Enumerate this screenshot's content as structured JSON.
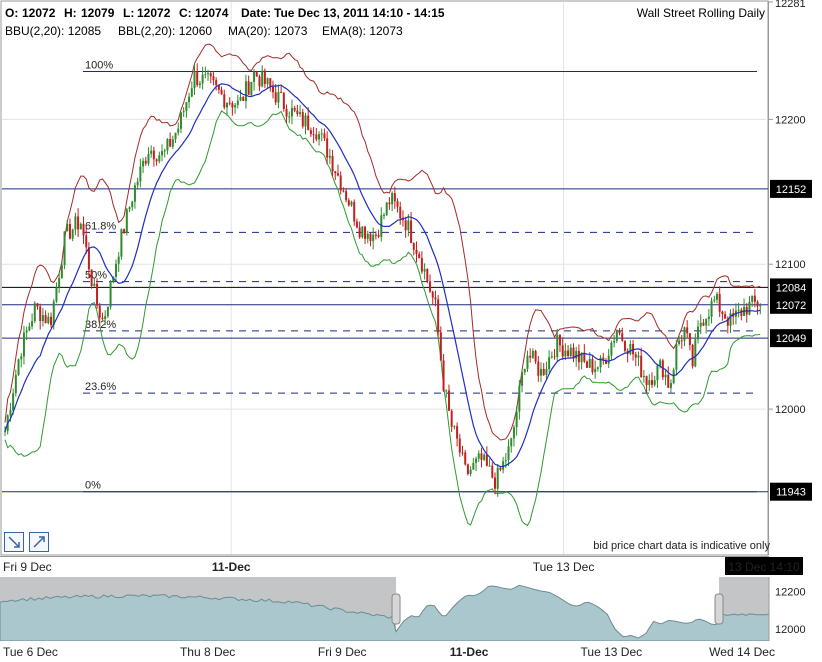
{
  "header": {
    "ohlc": [
      {
        "label": "O:",
        "value": "12072"
      },
      {
        "label": "H:",
        "value": "12079"
      },
      {
        "label": "L:",
        "value": "12072"
      },
      {
        "label": "C:",
        "value": "12074"
      }
    ],
    "date_label": "Date:",
    "date_value": "Tue Dec 13, 2011 14:10 - 14:15",
    "instrument": "Wall Street Rolling Daily",
    "indicators": [
      {
        "label": "BBU(2,20): 12085",
        "color": "#b22222"
      },
      {
        "label": "BBL(2,20): 12060",
        "color": "#2e8b2e"
      },
      {
        "label": "MA(20): 12073",
        "color": "#2233bb"
      },
      {
        "label": "EMA(8): 12073",
        "color": "#b22222"
      }
    ]
  },
  "note": "bid price chart data is indicative only",
  "tools": [
    {
      "name": "trend-down-tool-button",
      "icon": "arrow-down-right-icon"
    },
    {
      "name": "trend-up-tool-button",
      "icon": "arrow-up-right-icon"
    }
  ],
  "colors": {
    "candle_up": "#2e8b2e",
    "candle_down": "#c41e1e",
    "bb_upper": "#a52a2a",
    "bb_lower": "#2e9a2e",
    "ma": "#1f2fbf",
    "level_line": "#1a2a80",
    "price_tag_bg": "#000000",
    "navigator_fill": "#a9c7cc",
    "navigator_bg": "#bfc1c3"
  },
  "chart_data": {
    "type": "candlestick",
    "title": "Wall Street Rolling Daily",
    "ylim": [
      11900,
      12281
    ],
    "y_ticks": [
      {
        "value": 12281,
        "label": "12281"
      },
      {
        "value": 12200,
        "label": "12200"
      },
      {
        "value": 12100,
        "label": "12100"
      },
      {
        "value": 12000,
        "label": "12000"
      }
    ],
    "x_ticks": [
      {
        "label": "Fri 9 Dec",
        "x": 0.0,
        "bold": false
      },
      {
        "label": "11-Dec",
        "x": 0.3,
        "bold": true
      },
      {
        "label": "Tue 13 Dec",
        "x": 0.735,
        "bold": false
      }
    ],
    "current_time_label": "13 Dec 14:10",
    "horizontal_levels": [
      {
        "value": 12152,
        "label": "12152",
        "style": "solid"
      },
      {
        "value": 12084,
        "label": "12084",
        "style": "solid-black"
      },
      {
        "value": 12072,
        "label": "12072",
        "style": "solid"
      },
      {
        "value": 12049,
        "label": "12049",
        "style": "solid"
      },
      {
        "value": 11943,
        "label": "11943",
        "style": "solid"
      }
    ],
    "fibonacci": {
      "high": 12233,
      "low": 11943,
      "levels": [
        {
          "label": "100%",
          "value": 12233
        },
        {
          "label": "61.8%",
          "value": 12122
        },
        {
          "label": "50%",
          "value": 12088
        },
        {
          "label": "38.2%",
          "value": 12054
        },
        {
          "label": "23.6%",
          "value": 12011
        },
        {
          "label": "0%",
          "value": 11943
        }
      ]
    },
    "price_path": [
      [
        0.0,
        11985
      ],
      [
        0.02,
        12040
      ],
      [
        0.04,
        12070
      ],
      [
        0.06,
        12060
      ],
      [
        0.08,
        12120
      ],
      [
        0.1,
        12130
      ],
      [
        0.12,
        12075
      ],
      [
        0.13,
        12060
      ],
      [
        0.15,
        12110
      ],
      [
        0.17,
        12150
      ],
      [
        0.19,
        12180
      ],
      [
        0.21,
        12175
      ],
      [
        0.23,
        12195
      ],
      [
        0.25,
        12230
      ],
      [
        0.27,
        12225
      ],
      [
        0.29,
        12215
      ],
      [
        0.31,
        12210
      ],
      [
        0.33,
        12232
      ],
      [
        0.35,
        12222
      ],
      [
        0.37,
        12210
      ],
      [
        0.39,
        12200
      ],
      [
        0.41,
        12195
      ],
      [
        0.43,
        12175
      ],
      [
        0.45,
        12150
      ],
      [
        0.47,
        12125
      ],
      [
        0.49,
        12120
      ],
      [
        0.51,
        12145
      ],
      [
        0.53,
        12130
      ],
      [
        0.55,
        12105
      ],
      [
        0.57,
        12070
      ],
      [
        0.58,
        12020
      ],
      [
        0.59,
        11990
      ],
      [
        0.6,
        11975
      ],
      [
        0.61,
        11955
      ],
      [
        0.63,
        11965
      ],
      [
        0.65,
        11950
      ],
      [
        0.67,
        11975
      ],
      [
        0.69,
        12040
      ],
      [
        0.71,
        12025
      ],
      [
        0.73,
        12045
      ],
      [
        0.75,
        12040
      ],
      [
        0.77,
        12030
      ],
      [
        0.79,
        12030
      ],
      [
        0.81,
        12055
      ],
      [
        0.83,
        12040
      ],
      [
        0.85,
        12020
      ],
      [
        0.87,
        12030
      ],
      [
        0.88,
        12015
      ],
      [
        0.89,
        12045
      ],
      [
        0.9,
        12055
      ],
      [
        0.91,
        12030
      ],
      [
        0.92,
        12060
      ],
      [
        0.94,
        12075
      ],
      [
        0.96,
        12060
      ],
      [
        0.98,
        12070
      ],
      [
        1.0,
        12074
      ]
    ]
  },
  "navigator": {
    "x_ticks": [
      {
        "label": "Tue 6 Dec",
        "x": 0.0,
        "bold": false
      },
      {
        "label": "Thu 8 Dec",
        "x": 0.27,
        "bold": false
      },
      {
        "label": "Fri 9 Dec",
        "x": 0.445,
        "bold": false
      },
      {
        "label": "11-Dec",
        "x": 0.61,
        "bold": true
      },
      {
        "label": "Tue 13 Dec",
        "x": 0.795,
        "bold": false
      },
      {
        "label": "Wed 14 Dec",
        "x": 0.965,
        "bold": false
      }
    ],
    "y_ticks": [
      {
        "value": 12200,
        "label": "12200"
      },
      {
        "value": 12000,
        "label": "12000"
      }
    ],
    "window": [
      0.515,
      0.935
    ]
  }
}
